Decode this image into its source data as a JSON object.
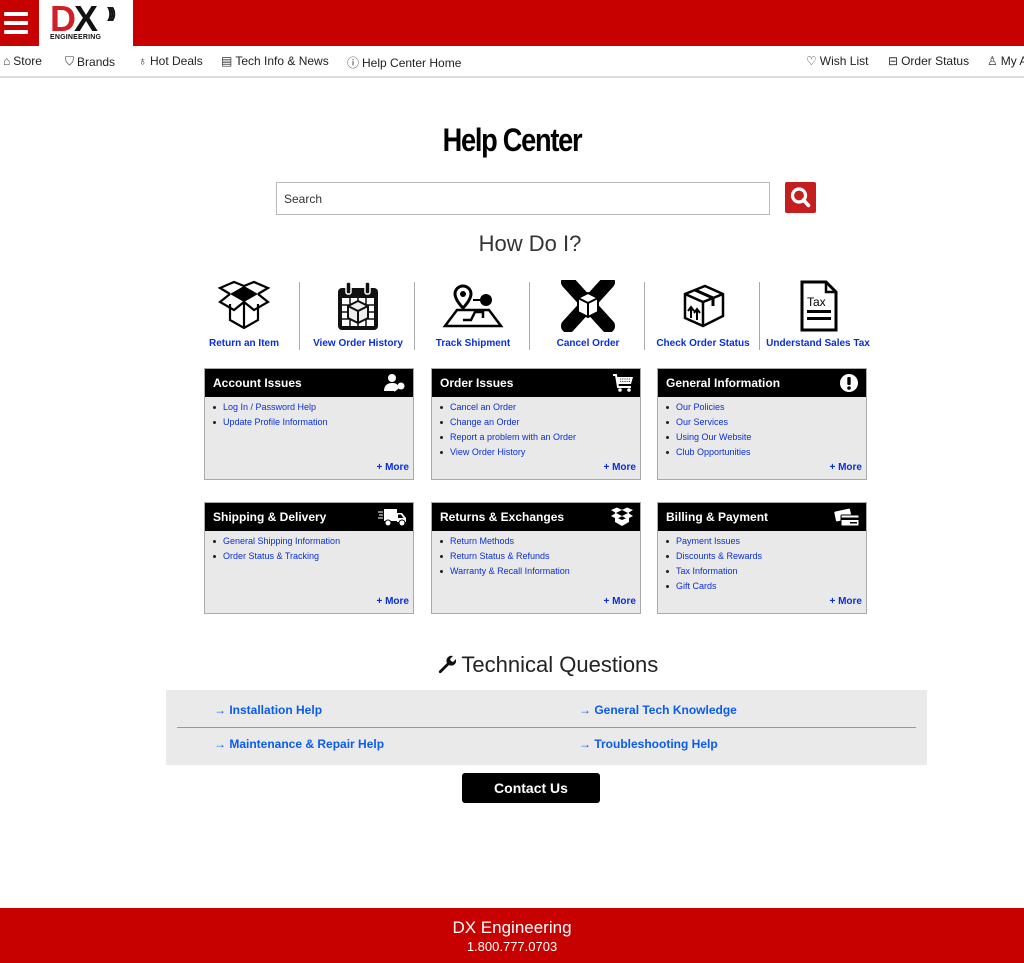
{
  "brand": {
    "logo_text": "DX",
    "logo_subtext": "ENGINEERING",
    "primary_color": "#c70000",
    "link_color": "#0a2fd6"
  },
  "nav": {
    "left": [
      {
        "icon": "home-icon",
        "label": "Store"
      },
      {
        "icon": "tag-icon",
        "label": "Brands"
      },
      {
        "icon": "flame-icon",
        "label": "Hot Deals"
      },
      {
        "icon": "newspaper-icon",
        "label": "Tech Info & News"
      },
      {
        "icon": "help-circle-icon",
        "label": "Help Center Home"
      }
    ],
    "right": [
      {
        "icon": "heart-icon",
        "label": "Wish List"
      },
      {
        "icon": "box-icon",
        "label": "Order Status"
      },
      {
        "icon": "user-icon",
        "label": "My A"
      }
    ]
  },
  "page": {
    "title": "Help Center",
    "search_placeholder": "Search",
    "how_do_i": "How Do I?"
  },
  "quick_links": [
    {
      "icon": "open-box-icon",
      "label": "Return an Item"
    },
    {
      "icon": "calendar-box-icon",
      "label": "View Order History"
    },
    {
      "icon": "map-pin-icon",
      "label": "Track Shipment"
    },
    {
      "icon": "cancel-box-icon",
      "label": "Cancel Order"
    },
    {
      "icon": "package-arrows-icon",
      "label": "Check Order Status"
    },
    {
      "icon": "tax-document-icon",
      "label": "Understand Sales Tax"
    }
  ],
  "cards": [
    {
      "title": "Account Issues",
      "icon": "user-key-icon",
      "items": [
        "Log In / Password Help",
        "Update Profile Information"
      ],
      "more": "+ More"
    },
    {
      "title": "Order Issues",
      "icon": "cart-icon",
      "items": [
        "Cancel an Order",
        "Change an Order",
        "Report a problem with an Order",
        "View Order History"
      ],
      "more": "+ More"
    },
    {
      "title": "General Information",
      "icon": "exclamation-icon",
      "items": [
        "Our Policies",
        "Our Services",
        "Using Our Website",
        "Club Opportunities"
      ],
      "more": "+ More"
    },
    {
      "title": "Shipping & Delivery",
      "icon": "truck-icon",
      "items": [
        "General Shipping Information",
        "Order Status & Tracking"
      ],
      "more": "+ More"
    },
    {
      "title": "Returns & Exchanges",
      "icon": "open-box-icon",
      "items": [
        "Return Methods",
        "Return Status & Refunds",
        "Warranty & Recall Information"
      ],
      "more": "+ More"
    },
    {
      "title": "Billing & Payment",
      "icon": "credit-card-icon",
      "items": [
        "Payment Issues",
        "Discounts & Rewards",
        "Tax Information",
        "Gift Cards"
      ],
      "more": "+ More"
    }
  ],
  "tech": {
    "title": "Technical Questions",
    "links": [
      "Installation Help",
      "General Tech Knowledge",
      "Maintenance & Repair Help",
      "Troubleshooting Help"
    ],
    "arrow": "→"
  },
  "contact_label": "Contact Us",
  "footer": {
    "name": "DX Engineering",
    "phone": "1.800.777.0703"
  }
}
